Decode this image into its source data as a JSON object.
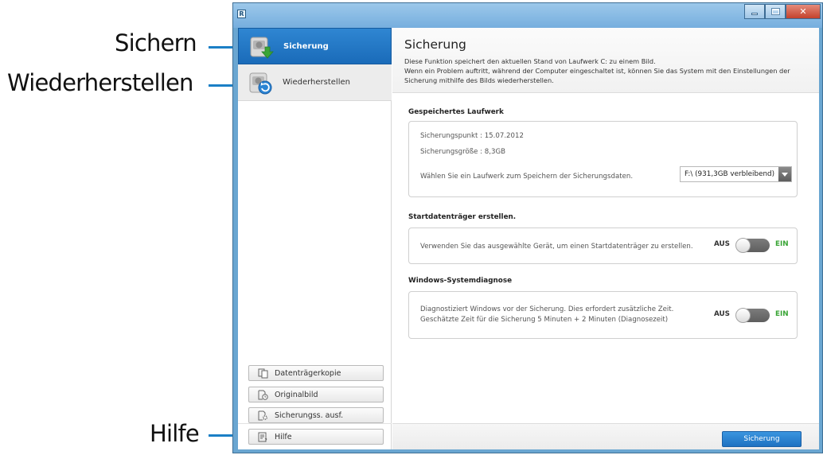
{
  "callouts": {
    "backup": "Sichern",
    "restore": "Wiederherstellen",
    "help": "Hilfe"
  },
  "window": {
    "title": ""
  },
  "sidebar": {
    "items": [
      {
        "label": "Sicherung",
        "icon": "backup-drive-icon",
        "active": true
      },
      {
        "label": "Wiederherstellen",
        "icon": "restore-drive-icon",
        "active": false
      }
    ],
    "tools": [
      {
        "label": "Datenträgerkopie",
        "icon": "disk-copy-icon"
      },
      {
        "label": "Originalbild",
        "icon": "original-image-icon"
      },
      {
        "label": "Sicherungss. ausf.",
        "icon": "backup-schedule-icon"
      },
      {
        "label": "Hilfe",
        "icon": "help-icon"
      }
    ]
  },
  "main": {
    "title": "Sicherung",
    "description": [
      "Diese Funktion speichert den aktuellen Stand von Laufwerk C: zu einem Bild.",
      "Wenn ein Problem auftritt, während der Computer eingeschaltet ist, können Sie das System mit den Einstellungen der",
      "Sicherung mithilfe des Bilds wiederherstellen."
    ],
    "saved_drive": {
      "title": "Gespeichertes Laufwerk",
      "backup_point": "Sicherungspunkt : 15.07.2012",
      "backup_size": "Sicherungsgröße : 8,3GB",
      "select_label": "Wählen Sie ein Laufwerk zum Speichern der Sicherungsdaten.",
      "select_value": "F:\\ (931,3GB verbleibend)"
    },
    "boot_media": {
      "title": "Startdatenträger erstellen.",
      "text": "Verwenden Sie das ausgewählte Gerät, um einen Startdatenträger zu erstellen.",
      "off_label": "AUS",
      "on_label": "EIN",
      "state": "off"
    },
    "diagnosis": {
      "title": "Windows-Systemdiagnose",
      "text_line1": "Diagnostiziert Windows vor der Sicherung. Dies erfordert zusätzliche Zeit.",
      "text_line2": "Geschätzte Zeit für die Sicherung 5 Minuten + 2 Minuten (Diagnosezeit)",
      "off_label": "AUS",
      "on_label": "EIN",
      "state": "off"
    },
    "primary_button": "Sicherung"
  },
  "colors": {
    "accent": "#1b7fc6",
    "active_nav": "#2379c6",
    "on_green": "#3aa536"
  }
}
